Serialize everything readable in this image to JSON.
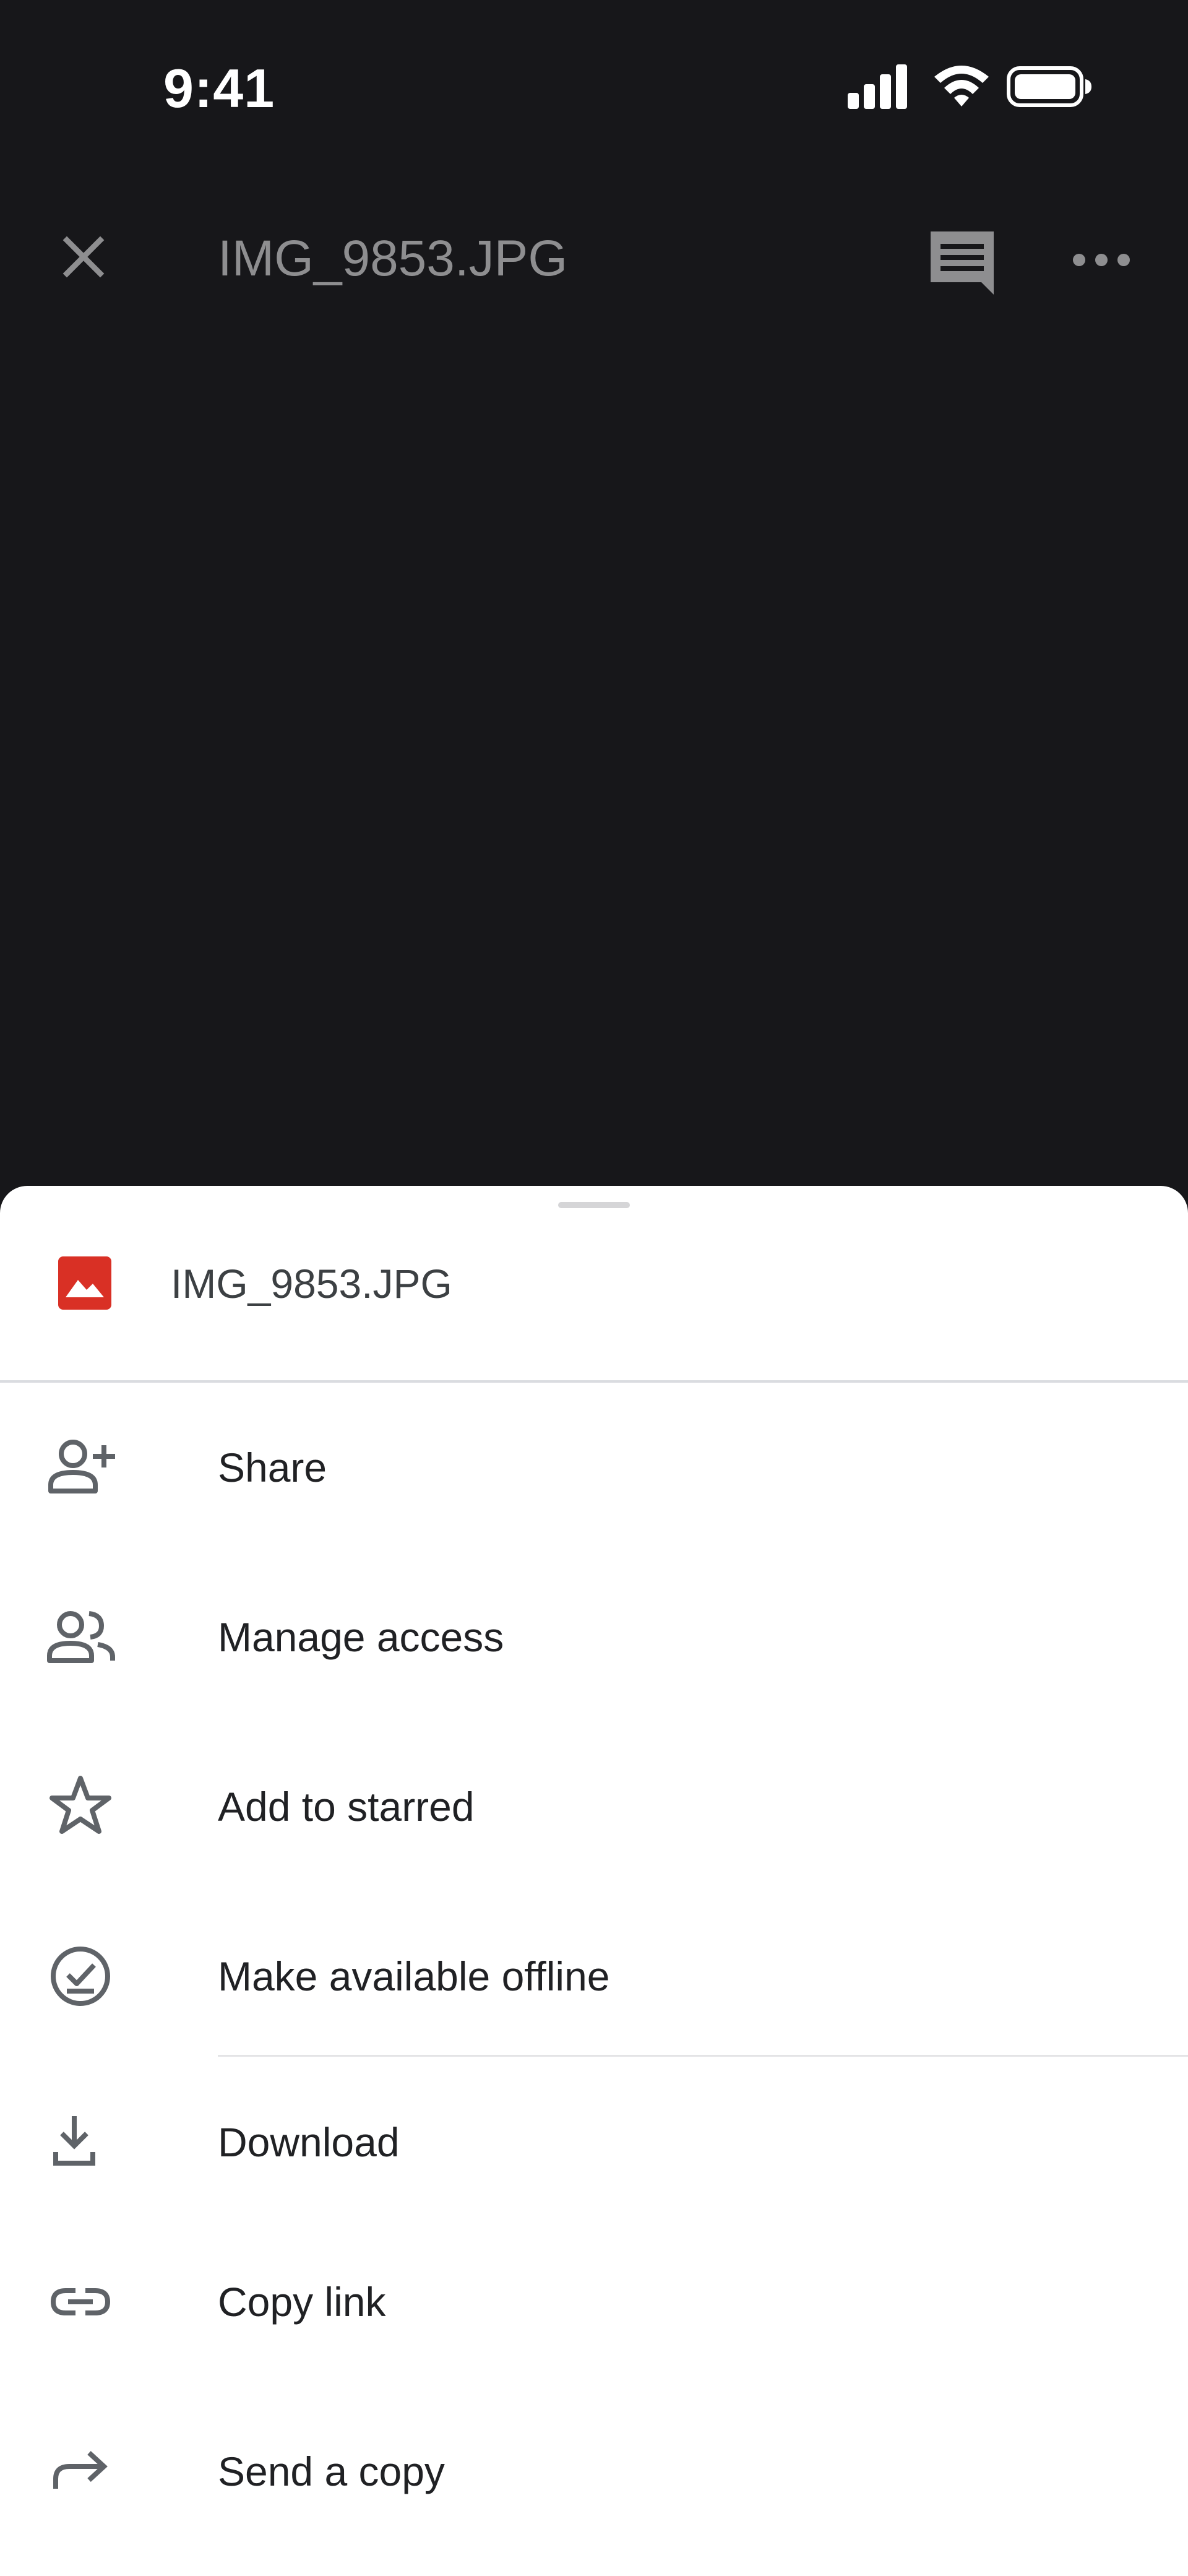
{
  "status_bar": {
    "time": "9:41"
  },
  "header": {
    "title": "IMG_9853.JPG",
    "icons": [
      "close-icon",
      "comment-icon",
      "more-horizontal-icon"
    ]
  },
  "sheet": {
    "file": {
      "name": "IMG_9853.JPG",
      "icon": "image-file-icon",
      "icon_color": "#D93025"
    },
    "items": [
      {
        "label": "Share",
        "icon": "person-add-icon"
      },
      {
        "label": "Manage access",
        "icon": "people-icon"
      },
      {
        "label": "Add to starred",
        "icon": "star-outline-icon"
      },
      {
        "label": "Make available offline",
        "icon": "offline-check-icon"
      },
      {
        "label": "Download",
        "icon": "download-icon"
      },
      {
        "label": "Copy link",
        "icon": "link-icon"
      },
      {
        "label": "Send a copy",
        "icon": "share-arrow-icon"
      }
    ]
  },
  "colors": {
    "background": "#17171A",
    "sheet": "#FFFFFF",
    "icon": "#5F6368",
    "text": "#202124"
  }
}
